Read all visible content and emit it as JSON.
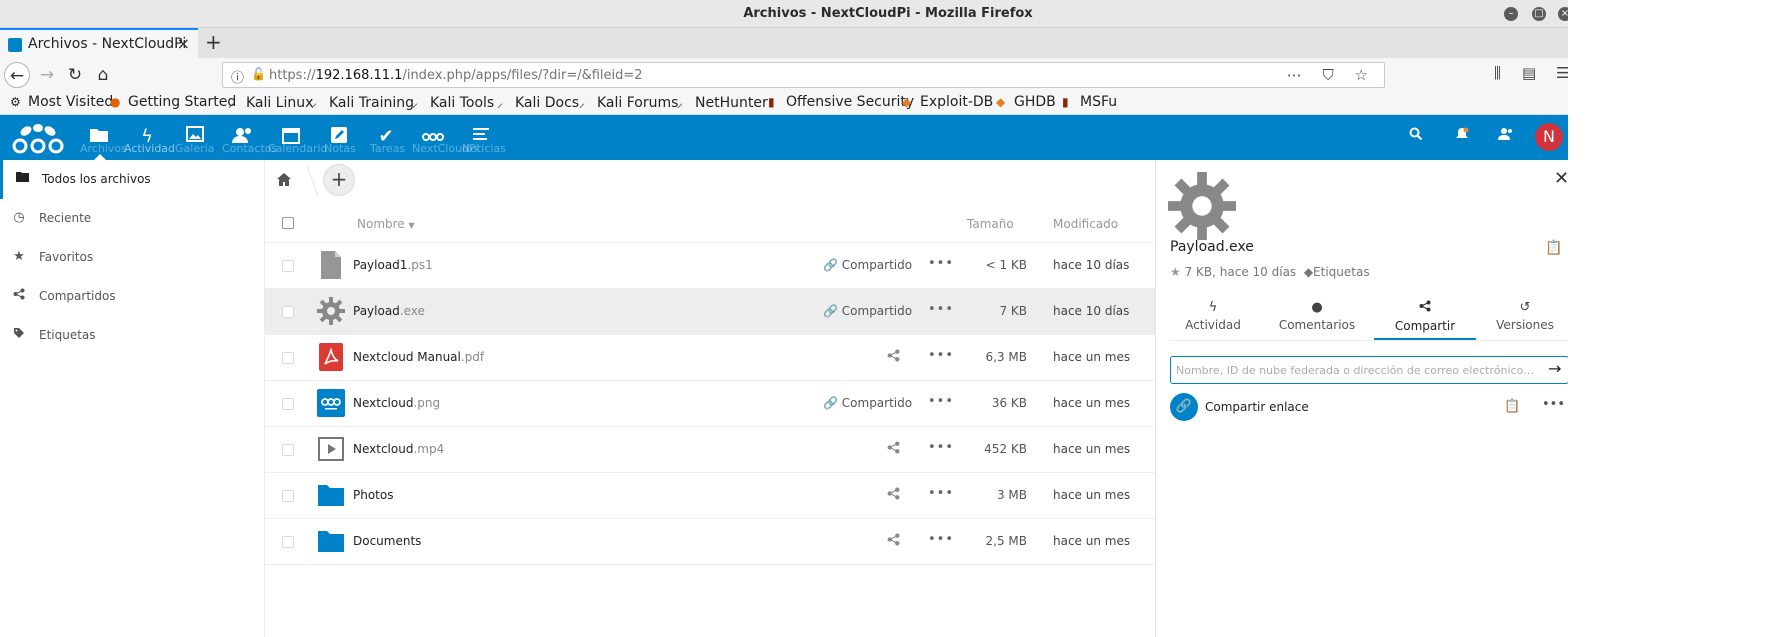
{
  "window": {
    "title": "Archivos - NextCloudPi - Mozilla Firefox"
  },
  "tab": {
    "title": "Archivos - NextCloudPi"
  },
  "url": {
    "prefix": "https://",
    "host": "192.168.11.1",
    "path": "/index.php/apps/files/?dir=/&fileid=2"
  },
  "bookmarks": [
    {
      "label": "Most Visited",
      "icon": "gear-icon"
    },
    {
      "label": "Getting Started",
      "icon": "firefox-icon"
    },
    {
      "label": "Kali Linux",
      "icon": "kali-dragon-icon"
    },
    {
      "label": "Kali Training",
      "icon": "kali-dragon-icon"
    },
    {
      "label": "Kali Tools",
      "icon": "kali-dragon-icon"
    },
    {
      "label": "Kali Docs",
      "icon": "kali-dragon-icon"
    },
    {
      "label": "Kali Forums",
      "icon": "kali-dragon-icon"
    },
    {
      "label": "NetHunter",
      "icon": "kali-dragon-icon"
    },
    {
      "label": "Offensive Security",
      "icon": "offsec-icon"
    },
    {
      "label": "Exploit-DB",
      "icon": "exploitdb-icon"
    },
    {
      "label": "GHDB",
      "icon": "exploitdb-icon"
    },
    {
      "label": "MSFu",
      "icon": "offsec-icon"
    }
  ],
  "header": {
    "apps": [
      {
        "name": "files",
        "label": "Archivos",
        "icon": "folder-icon"
      },
      {
        "name": "activity",
        "label": "Actividad",
        "icon": "lightning-icon"
      },
      {
        "name": "gallery",
        "label": "Galería",
        "icon": "image-icon"
      },
      {
        "name": "contacts",
        "label": "Contactos",
        "icon": "contacts-icon"
      },
      {
        "name": "calendar",
        "label": "Calendario",
        "icon": "calendar-icon"
      },
      {
        "name": "notes",
        "label": "Notas",
        "icon": "edit-icon"
      },
      {
        "name": "tasks",
        "label": "Tareas",
        "icon": "check-icon"
      },
      {
        "name": "ncp",
        "label": "NextCloudPi",
        "icon": "nextcloud-icon"
      },
      {
        "name": "news",
        "label": "Noticias",
        "icon": "list-icon"
      }
    ],
    "avatar_letter": "N",
    "accent": "#0082c9"
  },
  "nav": {
    "items": [
      {
        "label": "Todos los archivos",
        "icon": "folder-icon",
        "active": true
      },
      {
        "label": "Reciente",
        "icon": "clock-icon"
      },
      {
        "label": "Favoritos",
        "icon": "star-icon"
      },
      {
        "label": "Compartidos",
        "icon": "share-icon"
      },
      {
        "label": "Etiquetas",
        "icon": "tag-icon"
      }
    ]
  },
  "filelist": {
    "columns": {
      "name": "Nombre",
      "size": "Tamaño",
      "modified": "Modificado"
    },
    "rows": [
      {
        "base": "Payload1",
        "ext": ".ps1",
        "icon": "document-icon",
        "shared": "Compartido",
        "size": "< 1 KB",
        "modified": "hace 10 días"
      },
      {
        "base": "Payload",
        "ext": ".exe",
        "icon": "gear-icon",
        "shared": "Compartido",
        "size": "7 KB",
        "modified": "hace 10 días",
        "selected": true
      },
      {
        "base": "Nextcloud Manual",
        "ext": ".pdf",
        "icon": "pdf-icon",
        "shared": "",
        "size": "6,3 MB",
        "modified": "hace un mes"
      },
      {
        "base": "Nextcloud",
        "ext": ".png",
        "icon": "image-icon",
        "shared": "Compartido",
        "size": "36 KB",
        "modified": "hace un mes"
      },
      {
        "base": "Nextcloud",
        "ext": ".mp4",
        "icon": "video-icon",
        "shared": "",
        "size": "452 KB",
        "modified": "hace un mes"
      },
      {
        "base": "Photos",
        "ext": "",
        "icon": "folder-icon",
        "shared": "",
        "size": "3 MB",
        "modified": "hace un mes"
      },
      {
        "base": "Documents",
        "ext": "",
        "icon": "folder-icon",
        "shared": "",
        "size": "2,5 MB",
        "modified": "hace un mes"
      }
    ]
  },
  "sidebar": {
    "filename": "Payload.exe",
    "meta": "7 KB, hace 10 días",
    "tags": "Etiquetas",
    "tabs": [
      {
        "label": "Actividad",
        "icon": "lightning-icon"
      },
      {
        "label": "Comentarios",
        "icon": "comment-icon"
      },
      {
        "label": "Compartir",
        "icon": "share-icon",
        "active": true
      },
      {
        "label": "Versiones",
        "icon": "history-icon"
      }
    ],
    "share_placeholder": "Nombre, ID de nube federada o dirección de correo electrónico…",
    "share_link_label": "Compartir enlace"
  }
}
